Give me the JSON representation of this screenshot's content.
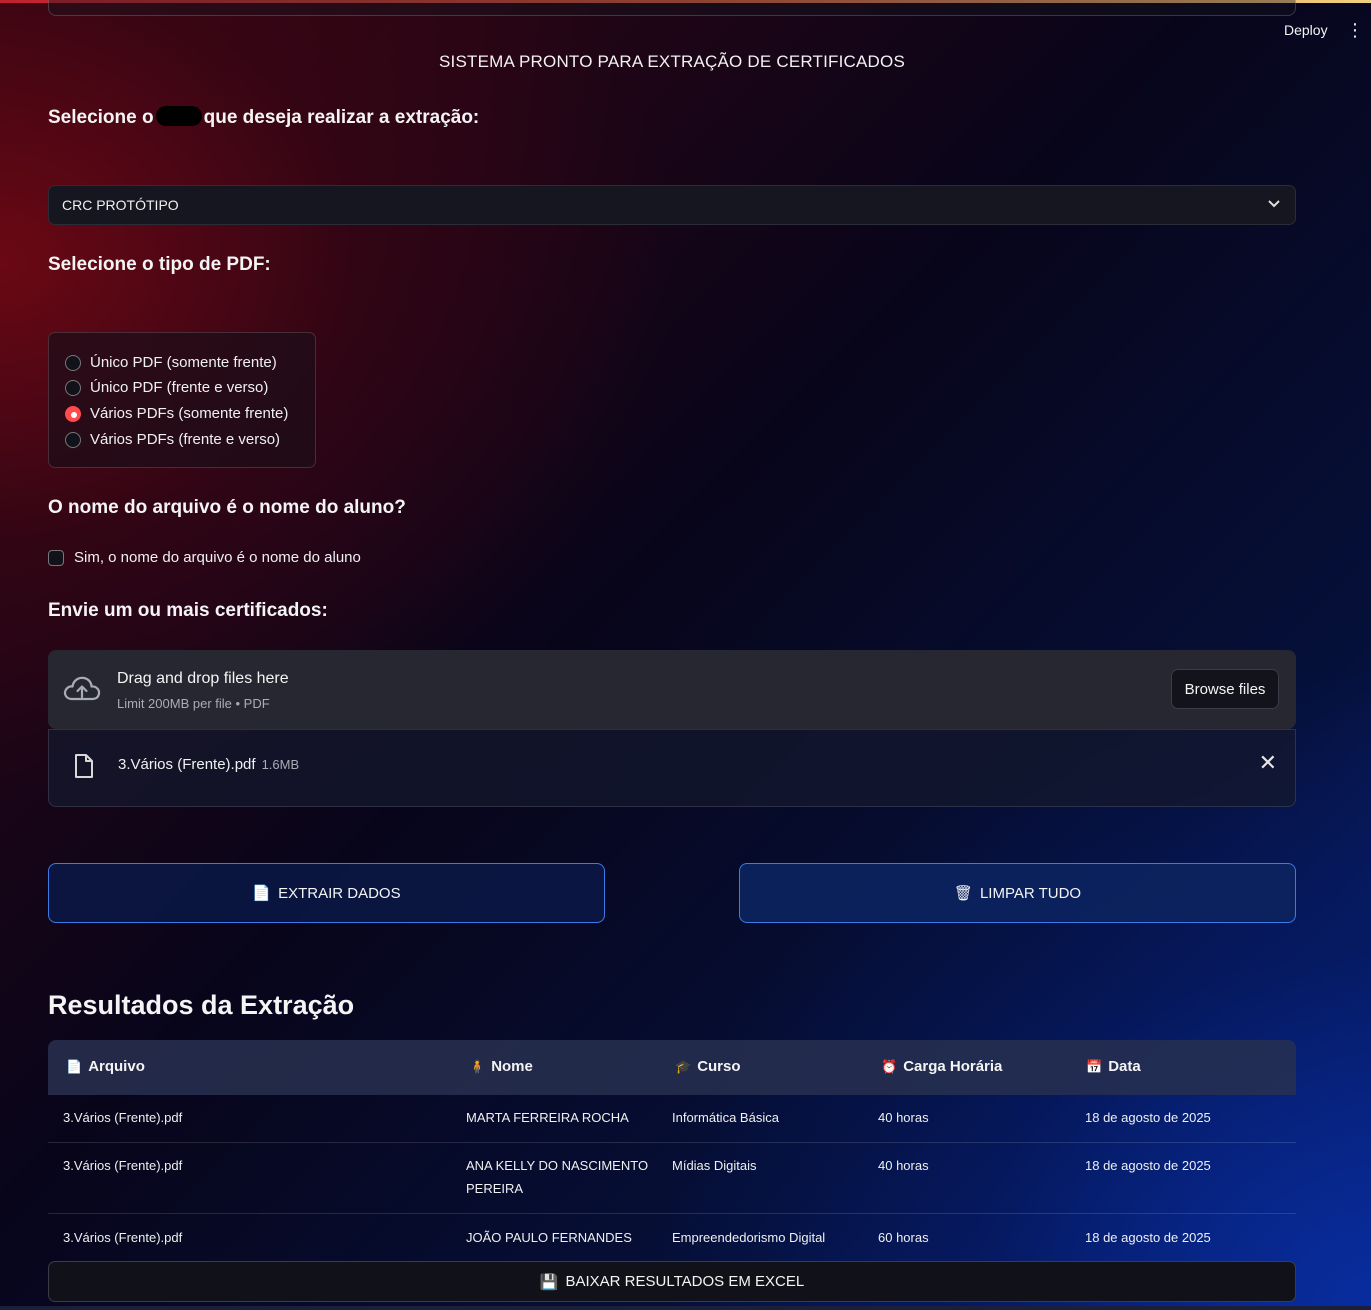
{
  "topbar": {
    "deploy_label": "Deploy",
    "menu_icon": "kebab-menu-icon"
  },
  "header": {
    "title": "SISTEMA PRONTO PARA EXTRAÇÃO DE CERTIFICADOS"
  },
  "section_select": {
    "label_prefix": "Selecione o",
    "label_suffix": "que deseja realizar a extração:",
    "selected_value": "CRC PROTÓTIPO"
  },
  "section_pdf_type": {
    "label": "Selecione o tipo de PDF:",
    "options": [
      {
        "label": "Único PDF (somente frente)",
        "selected": false
      },
      {
        "label": "Único PDF (frente e verso)",
        "selected": false
      },
      {
        "label": "Vários PDFs (somente frente)",
        "selected": true
      },
      {
        "label": "Vários PDFs (frente e verso)",
        "selected": false
      }
    ]
  },
  "section_filename": {
    "label": "O nome do arquivo é o nome do aluno?",
    "checkbox_label": "Sim, o nome do arquivo é o nome do aluno",
    "checked": false
  },
  "section_upload": {
    "label": "Envie um ou mais certificados:",
    "drop_title": "Drag and drop files here",
    "drop_hint": "Limit 200MB per file • PDF",
    "browse_label": "Browse files",
    "file": {
      "name": "3.Vários (Frente).pdf",
      "size": "1.6MB"
    }
  },
  "actions": {
    "extract_label": "EXTRAIR DADOS",
    "clear_label": "LIMPAR TUDO",
    "extract_icon": "📄",
    "clear_icon": "🗑"
  },
  "results": {
    "title": "Resultados da Extração",
    "columns": [
      {
        "icon": "📄",
        "label": "Arquivo"
      },
      {
        "icon": "🧍",
        "label": "Nome"
      },
      {
        "icon": "🎓",
        "label": "Curso"
      },
      {
        "icon": "⏰",
        "label": "Carga Horária"
      },
      {
        "icon": "📅",
        "label": "Data"
      }
    ],
    "rows": [
      [
        "3.Vários (Frente).pdf",
        "MARTA FERREIRA ROCHA",
        "Informática Básica",
        "40 horas",
        "18 de agosto de 2025"
      ],
      [
        "3.Vários (Frente).pdf",
        "ANA KELLY DO NASCIMENTO PEREIRA",
        "Mídias Digitais",
        "40 horas",
        "18 de agosto de 2025"
      ],
      [
        "3.Vários (Frente).pdf",
        "JOÃO PAULO FERNANDES",
        "Empreendedorismo Digital",
        "60 horas",
        "18 de agosto de 2025"
      ]
    ],
    "download_label": "BAIXAR RESULTADOS EM EXCEL",
    "download_icon": "💾"
  }
}
